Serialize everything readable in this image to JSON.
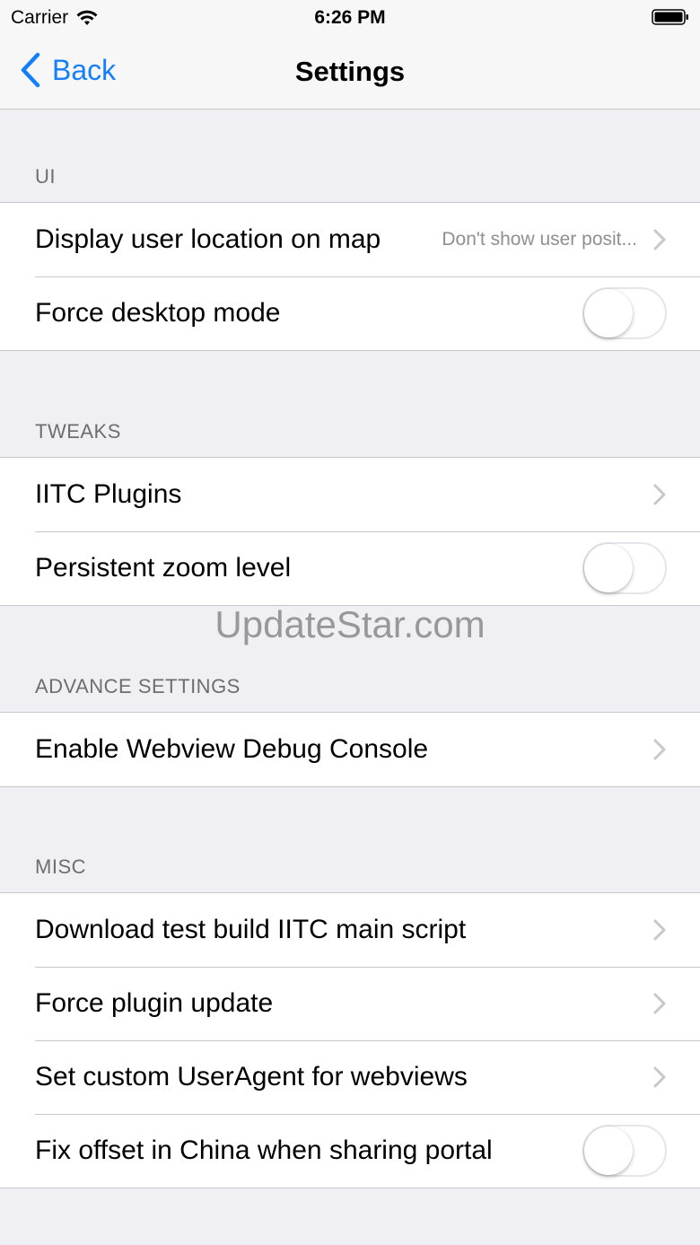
{
  "status": {
    "carrier": "Carrier",
    "time": "6:26 PM"
  },
  "nav": {
    "back_label": "Back",
    "title": "Settings"
  },
  "sections": {
    "ui": {
      "header": "UI",
      "display_location": {
        "label": "Display user location on map",
        "detail": "Don't show user posit..."
      },
      "force_desktop": {
        "label": "Force desktop mode",
        "on": false
      }
    },
    "tweaks": {
      "header": "TWEAKS",
      "plugins": {
        "label": "IITC Plugins"
      },
      "persistent_zoom": {
        "label": "Persistent zoom level",
        "on": false
      }
    },
    "advance": {
      "header": "ADVANCE SETTINGS",
      "debug_console": {
        "label": "Enable Webview Debug Console"
      }
    },
    "misc": {
      "header": "MISC",
      "download_test": {
        "label": "Download test build IITC main script"
      },
      "force_plugin_update": {
        "label": "Force plugin update"
      },
      "user_agent": {
        "label": "Set custom UserAgent for webviews"
      },
      "fix_offset": {
        "label": "Fix offset in China when sharing portal",
        "on": false
      }
    }
  },
  "watermark": "UpdateStar.com",
  "colors": {
    "accent": "#147efb",
    "background": "#efeff4",
    "separator": "#c8c7cc",
    "secondary_text": "#8e8e93"
  },
  "icons": [
    "wifi-icon",
    "battery-icon",
    "back-chevron-icon",
    "chevron-right-icon"
  ]
}
